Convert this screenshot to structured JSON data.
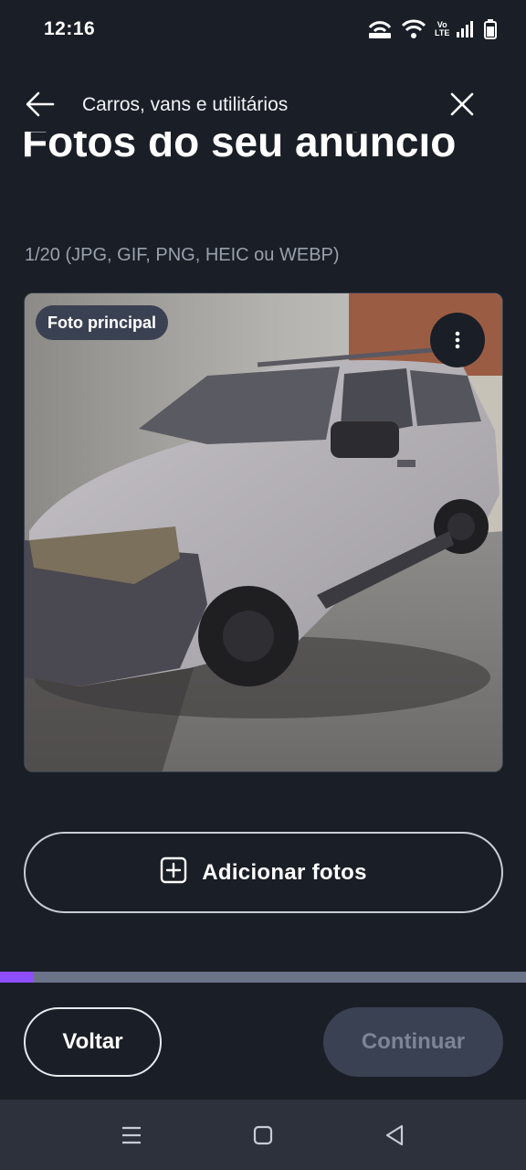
{
  "status_bar": {
    "time": "12:16",
    "icons": [
      "hotspot-icon",
      "wifi-icon",
      "volte-icon",
      "signal-icon",
      "battery-icon"
    ],
    "volte_text": "Vo LTE"
  },
  "top_bar": {
    "title": "Carros, vans e utilitários",
    "back_icon": "arrow-left-icon",
    "close_icon": "close-icon"
  },
  "heading": "Fotos do seu anúncio",
  "file_info": "1/20 (JPG, GIF, PNG, HEIC ou WEBP)",
  "photo": {
    "badge": "Foto principal",
    "menu_icon": "more-vertical-icon"
  },
  "add_photos": {
    "label": "Adicionar fotos",
    "icon": "plus-square-icon"
  },
  "progress": {
    "fraction": 0.0625,
    "fill_color": "#8e4dff",
    "track_color": "#6b7388"
  },
  "actions": {
    "back_label": "Voltar",
    "continue_label": "Continuar"
  },
  "nav_bar": {
    "icons": [
      "menu-icon",
      "home-icon",
      "back-triangle-icon"
    ]
  }
}
